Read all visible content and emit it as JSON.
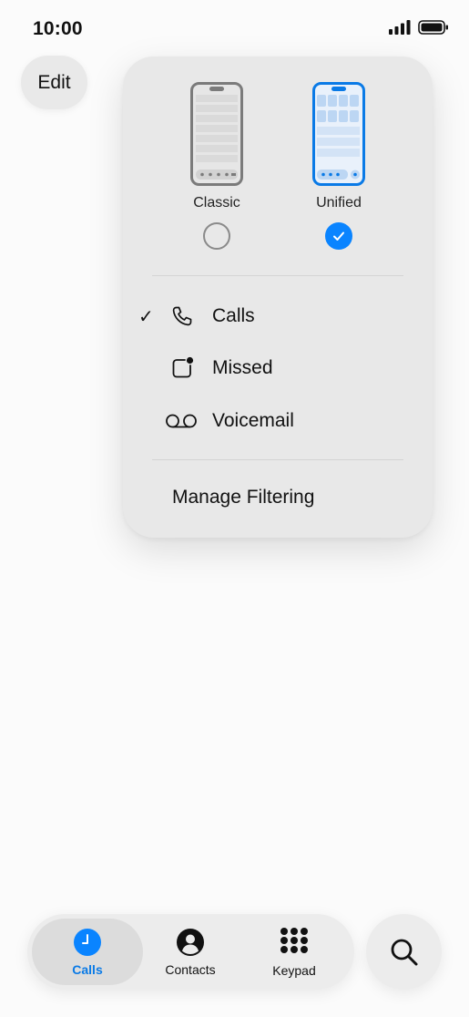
{
  "status_bar": {
    "time": "10:00"
  },
  "edit_button": {
    "label": "Edit"
  },
  "layout_picker": {
    "classic": {
      "label": "Classic",
      "selected": false
    },
    "unified": {
      "label": "Unified",
      "selected": true
    }
  },
  "filter_menu": {
    "items": [
      {
        "label": "Calls",
        "icon": "phone-icon",
        "checked": true
      },
      {
        "label": "Missed",
        "icon": "missed-icon",
        "checked": false
      },
      {
        "label": "Voicemail",
        "icon": "voicemail-icon",
        "checked": false
      }
    ],
    "check_glyph": "✓",
    "manage_label": "Manage Filtering"
  },
  "tab_bar": {
    "tabs": [
      {
        "label": "Calls",
        "icon": "clock-icon",
        "active": true
      },
      {
        "label": "Contacts",
        "icon": "person-icon",
        "active": false
      },
      {
        "label": "Keypad",
        "icon": "keypad-icon",
        "active": false
      }
    ]
  },
  "search_button": {
    "icon": "search-icon"
  },
  "colors": {
    "accent": "#0a84ff",
    "active_tab_text": "#0a7ae6"
  }
}
